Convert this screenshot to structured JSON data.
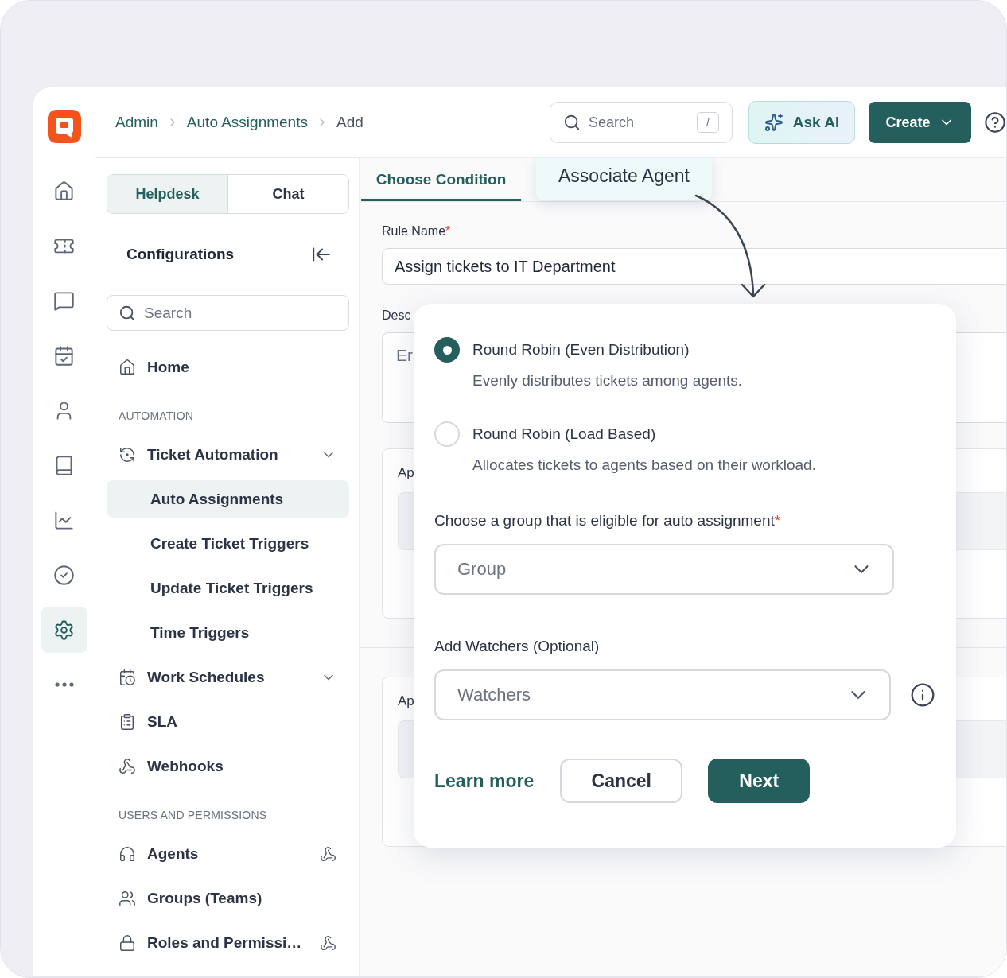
{
  "breadcrumb": [
    {
      "label": "Admin",
      "current": false
    },
    {
      "label": "Auto Assignments",
      "current": false
    },
    {
      "label": "Add",
      "current": true
    }
  ],
  "top_search": {
    "placeholder": "Search",
    "shortcut": "/"
  },
  "ask_ai": {
    "label": "Ask AI"
  },
  "create_button": {
    "label": "Create"
  },
  "rail": [
    {
      "selected": false
    },
    {
      "selected": false
    },
    {
      "selected": false
    },
    {
      "selected": false
    },
    {
      "selected": false
    },
    {
      "selected": false
    },
    {
      "selected": false
    },
    {
      "selected": false
    },
    {
      "selected": true
    },
    {
      "selected": false
    }
  ],
  "nav_tabs": [
    {
      "label": "Helpdesk",
      "selected": true
    },
    {
      "label": "Chat",
      "selected": false
    }
  ],
  "nav_title": "Configurations",
  "nav_search": {
    "placeholder": "Search"
  },
  "nav_items": [
    {
      "kind": "item",
      "label": "Home"
    },
    {
      "kind": "section",
      "label": "AUTOMATION"
    },
    {
      "kind": "item",
      "label": "Ticket Automation",
      "expandable": true,
      "children": [
        {
          "label": "Auto Assignments",
          "selected": true
        },
        {
          "label": "Create Ticket Triggers",
          "selected": false
        },
        {
          "label": "Update Ticket Triggers",
          "selected": false
        },
        {
          "label": "Time Triggers",
          "selected": false
        }
      ]
    },
    {
      "kind": "item",
      "label": "Work Schedules",
      "expandable": true
    },
    {
      "kind": "item",
      "label": "SLA"
    },
    {
      "kind": "item",
      "label": "Webhooks"
    },
    {
      "kind": "section",
      "label": "USERS AND PERMISSIONS"
    },
    {
      "kind": "item",
      "label": "Agents",
      "trailing": true
    },
    {
      "kind": "item",
      "label": "Groups (Teams)"
    },
    {
      "kind": "item",
      "label": "Roles and Permissi…",
      "trailing": true
    }
  ],
  "tabs": [
    {
      "label": "Choose Condition",
      "selected": true
    }
  ],
  "callout": {
    "text": "Associate Agent"
  },
  "form": {
    "rule_name": {
      "label": "Rule Name",
      "required_mark": "*",
      "value": "Assign tickets to IT Department"
    },
    "description": {
      "label": "Desc",
      "placeholder": "Er"
    },
    "sections": [
      {
        "label": "Ap"
      },
      {
        "label": "Ap"
      }
    ]
  },
  "modal": {
    "options": [
      {
        "title": "Round Robin (Even Distribution)",
        "description": "Evenly distributes tickets among agents.",
        "selected": true
      },
      {
        "title": "Round Robin (Load Based)",
        "description": "Allocates tickets to agents based on their workload.",
        "selected": false
      }
    ],
    "group_field": {
      "label": "Choose a group that is eligible for auto assignment",
      "required_mark": "*",
      "placeholder": "Group"
    },
    "watchers_field": {
      "label": "Add Watchers (Optional)",
      "placeholder": "Watchers"
    },
    "learn_more": "Learn more",
    "cancel": "Cancel",
    "next": "Next"
  }
}
